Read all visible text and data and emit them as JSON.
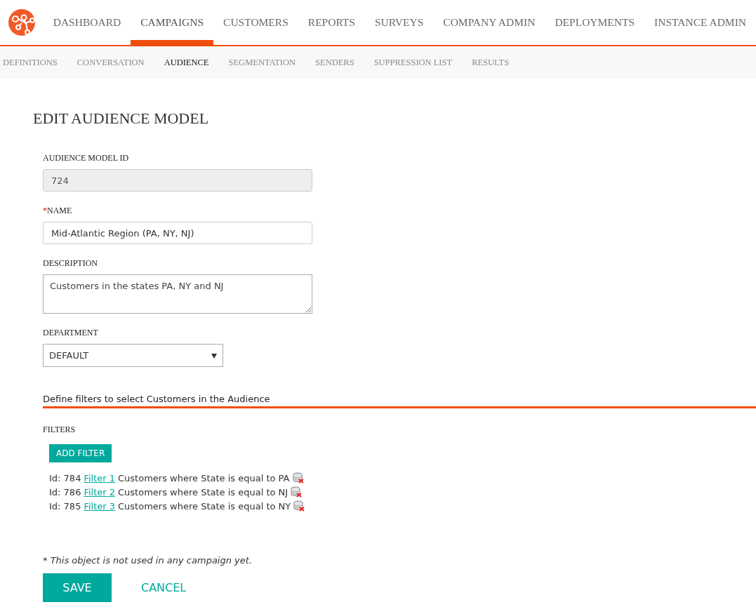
{
  "nav": {
    "items": [
      {
        "label": "DASHBOARD",
        "selected": false
      },
      {
        "label": "CAMPAIGNS",
        "selected": true
      },
      {
        "label": "CUSTOMERS",
        "selected": false
      },
      {
        "label": "REPORTS",
        "selected": false
      },
      {
        "label": "SURVEYS",
        "selected": false
      },
      {
        "label": "COMPANY ADMIN",
        "selected": false
      },
      {
        "label": "DEPLOYMENTS",
        "selected": false
      },
      {
        "label": "INSTANCE ADMIN",
        "selected": false
      }
    ]
  },
  "subnav": {
    "items": [
      {
        "label": "DEFINITIONS",
        "selected": false
      },
      {
        "label": "CONVERSATION",
        "selected": false
      },
      {
        "label": "AUDIENCE",
        "selected": true
      },
      {
        "label": "SEGMENTATION",
        "selected": false
      },
      {
        "label": "SENDERS",
        "selected": false
      },
      {
        "label": "SUPPRESSION LIST",
        "selected": false
      },
      {
        "label": "RESULTS",
        "selected": false
      }
    ]
  },
  "heading": "EDIT AUDIENCE MODEL",
  "fields": [
    {
      "kind": "text",
      "label": "AUDIENCE MODEL ID",
      "value": "724",
      "disabled": true
    },
    {
      "kind": "text",
      "label": "NAME",
      "required_mark": "*",
      "value": "Mid-Atlantic Region (PA, NY, NJ)",
      "disabled": false
    },
    {
      "kind": "textarea",
      "label": "DESCRIPTION",
      "value": "Customers in the states PA, NY and NJ"
    },
    {
      "kind": "select",
      "label": "DEPARTMENT",
      "value": "DEFAULT"
    }
  ],
  "filters_section": {
    "title": "Define filters to select Customers in the Audience",
    "label": "FILTERS",
    "add_button": "ADD FILTER",
    "filters": [
      {
        "id": "Id: 784",
        "link": "Filter 1",
        "text": "Customers where State is equal to PA"
      },
      {
        "id": "Id: 786",
        "link": "Filter 2",
        "text": "Customers where State is equal to NJ"
      },
      {
        "id": "Id: 785",
        "link": "Filter 3",
        "text": "Customers where State is equal to NY"
      }
    ]
  },
  "note": "* This object is not used in any campaign yet.",
  "buttons": {
    "save": "SAVE",
    "cancel": "CANCEL"
  }
}
